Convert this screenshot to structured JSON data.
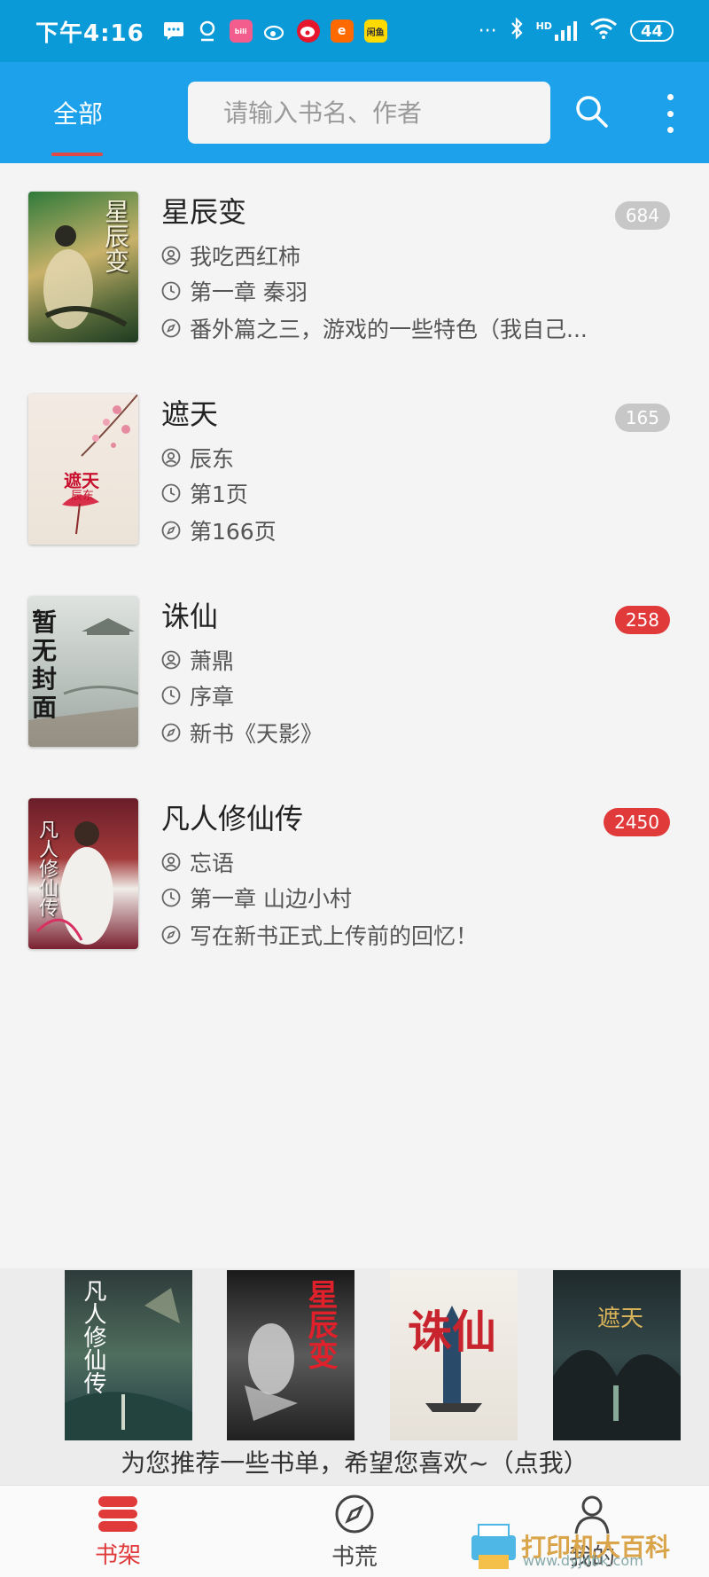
{
  "status_bar": {
    "time": "下午4:16",
    "app_icons": [
      {
        "name": "message-icon",
        "color": "#ffffff"
      },
      {
        "name": "location-icon",
        "color": "#ffffff"
      },
      {
        "name": "bilibili-icon",
        "label": "bilibili",
        "color": "#f25d8e"
      },
      {
        "name": "weibo-icon",
        "color": "#ffffff"
      },
      {
        "name": "weibo-color-icon",
        "color": "#e6162d"
      },
      {
        "name": "app-orange-icon",
        "color": "#ff6a00"
      },
      {
        "name": "xianyu-icon",
        "label": "闲鱼",
        "color": "#ffda00"
      }
    ],
    "more": "···",
    "bluetooth": "✱",
    "signal": "HD",
    "battery": "44"
  },
  "header": {
    "tab_label": "全部",
    "search_placeholder": "请输入书名、作者",
    "accent": "#1da1ea",
    "underline_color": "#e04a46"
  },
  "books": [
    {
      "title": "星辰变",
      "author": "我吃西红柿",
      "read_chapter": "第一章 秦羽",
      "latest_chapter": "番外篇之三，游戏的一些特色（我自己...",
      "unread_count": "684",
      "badge_style": "grey",
      "cover_text": "星辰变"
    },
    {
      "title": "遮天",
      "author": "辰东",
      "read_chapter": "第1页",
      "latest_chapter": "第166页",
      "unread_count": "165",
      "badge_style": "grey",
      "cover_text": "遮天",
      "cover_subtext": "辰东"
    },
    {
      "title": "诛仙",
      "author": "萧鼎",
      "read_chapter": "序章",
      "latest_chapter": "新书《天影》",
      "unread_count": "258",
      "badge_style": "red",
      "cover_text": "暂无封面"
    },
    {
      "title": "凡人修仙传",
      "author": "忘语",
      "read_chapter": "第一章 山边小村",
      "latest_chapter": "写在新书正式上传前的回忆！",
      "unread_count": "2450",
      "badge_style": "red",
      "cover_text": "凡人修仙传"
    }
  ],
  "recommendation": {
    "text": "为您推荐一些书单，希望您喜欢~（点我）",
    "posters": [
      "凡人修仙传",
      "星辰变",
      "诛仙",
      "遮天"
    ]
  },
  "bottom_nav": {
    "items": [
      {
        "label": "书架",
        "icon": "bookshelf-icon",
        "active": true
      },
      {
        "label": "书荒",
        "icon": "compass-icon",
        "active": false
      },
      {
        "label": "我的",
        "icon": "profile-icon",
        "active": false
      }
    ],
    "active_color": "#e03a3a",
    "inactive_color": "#444444"
  },
  "watermark": {
    "text": "打印机大百科",
    "url": "www.dyjdbk.com"
  }
}
